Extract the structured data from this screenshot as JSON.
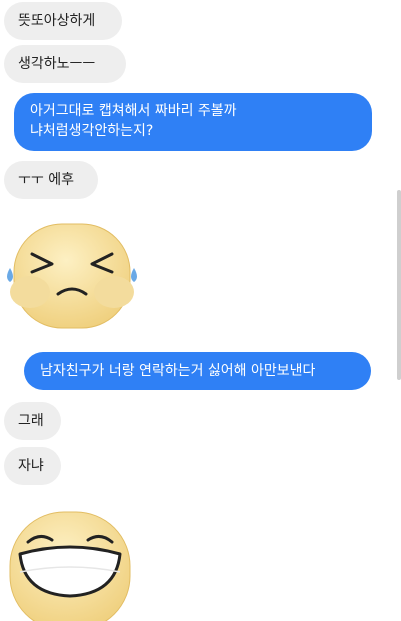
{
  "messages": [
    {
      "text": "뜻또아상하게"
    },
    {
      "text": "생각하노ㅡㅡ"
    },
    {
      "text_line1": "아거그대로 캡쳐해서 짜바리 주볼까",
      "text_line2": "냐처럼생각안하는지?"
    },
    {
      "text": "ㅜㅜ 에후"
    },
    {
      "text": "남자친구가 너랑 연락하는거 싫어해 아만보낸다"
    },
    {
      "text": "그래"
    },
    {
      "text": "자냐"
    }
  ],
  "stickers": [
    {
      "icon": "crying-face-sticker",
      "color": "#f6dc93"
    },
    {
      "icon": "grinning-face-sticker",
      "color": "#f6dc93"
    }
  ],
  "colors": {
    "outgoing_bubble": "#2f80f5",
    "incoming_bubble": "#eeeeee"
  }
}
